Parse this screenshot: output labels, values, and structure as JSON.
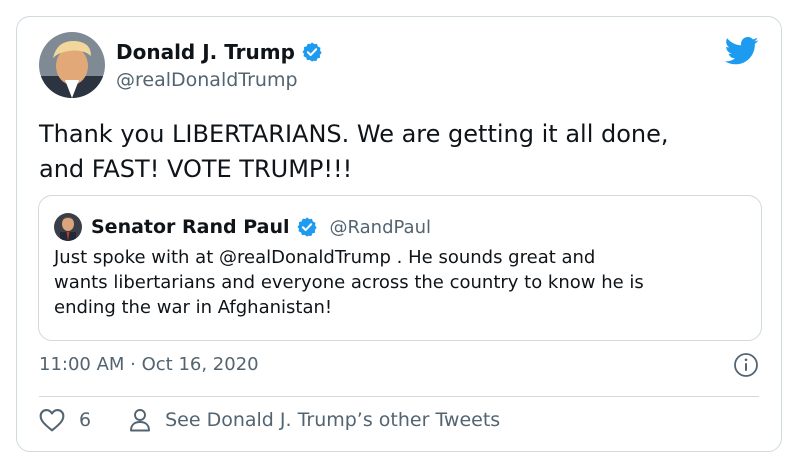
{
  "tweet": {
    "author": {
      "name": "Donald J. Trump",
      "handle": "@realDonaldTrump",
      "avatar_icon": "trump-avatar",
      "verified_icon": "verified-badge-icon"
    },
    "text_lines": [
      "Thank you LIBERTARIANS. We are getting it all done,",
      "and FAST! VOTE TRUMP!!!"
    ],
    "timestamp": "11:00 AM · Oct 16, 2020",
    "like_count": "6",
    "see_other_label": "See Donald J. Trump’s other Tweets"
  },
  "quoted_tweet": {
    "name": "Senator Rand Paul",
    "handle": "@RandPaul",
    "text_lines": [
      "Just spoke with at @realDonaldTrump . He sounds great and",
      "wants libertarians and everyone across the country to know he is",
      "ending the war in Afghanistan!"
    ]
  },
  "icons": {
    "brand": "twitter-bird-icon",
    "info": "info-icon",
    "like": "heart-icon",
    "profile": "person-icon"
  },
  "colors": {
    "brand_blue": "#1d9bf0",
    "text_primary": "#0f1419",
    "text_secondary": "#536471",
    "border": "#cfd9de"
  }
}
